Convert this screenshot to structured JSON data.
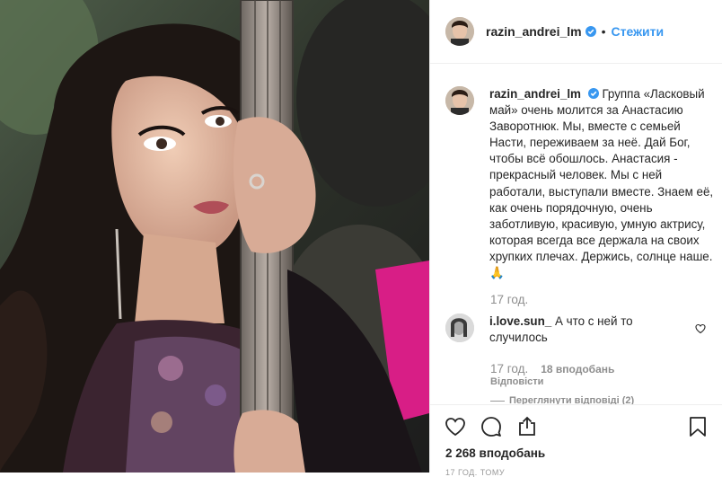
{
  "post": {
    "author": "razin_andrei_lm",
    "follow_label": "Стежити",
    "separator": "•",
    "caption_text": "Группа «Ласковый май» очень молится за Анастасию Заворотнюк. Мы, вместе с семьей Насти, переживаем за неё. Дай Бог, чтобы всё обошлось. Анастасия - прекрасный человек. Мы с ней работали, выступали вместе. Знаем её, как очень порядочную, очень заботливую, красивую, умную актрису, которая всегда все держала на своих хрупких плечах. Держись, солнце наше.🙏",
    "caption_time": "17 год.",
    "likes": "2 268 вподобань",
    "date": "17 ГОД. ТОМУ"
  },
  "comment": {
    "author": "i.love.sun_",
    "text": "А что с ней то случилось",
    "time": "17 год.",
    "likes": "18 вподобань",
    "reply_label": "Відповісти",
    "view_replies": "Переглянути відповіді (2)"
  },
  "icons": {
    "like": "heart-icon",
    "comment": "comment-icon",
    "share": "share-icon",
    "save": "bookmark-icon",
    "verified": "verified-badge-icon",
    "comment_like": "heart-icon"
  },
  "colors": {
    "link": "#3897f0",
    "verified": "#3897f0",
    "text": "#262626",
    "muted": "#8e8e8e",
    "border": "#efefef"
  }
}
